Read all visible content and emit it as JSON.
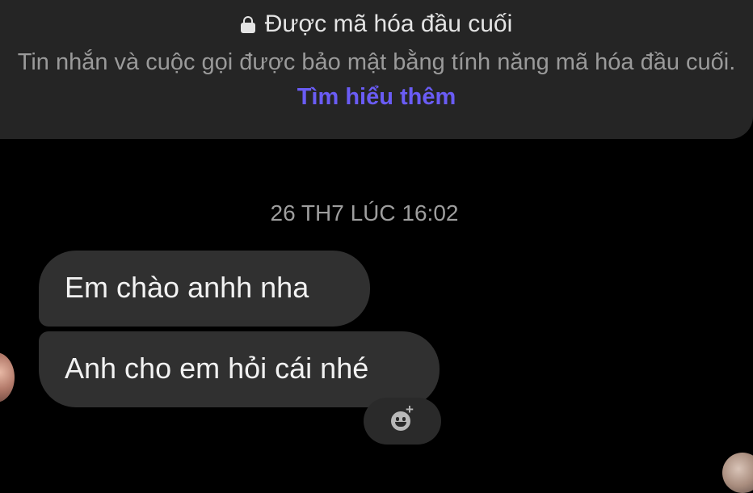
{
  "encryption_notice": {
    "title": "Được mã hóa đầu cuối",
    "description": "Tin nhắn và cuộc gọi được bảo mật bằng tính năng mã hóa đầu cuối.",
    "learn_more": "Tìm hiểu thêm",
    "icon": "lock-icon"
  },
  "conversation": {
    "timestamp": "26 TH7 LÚC 16:02",
    "messages": [
      {
        "text": "Em chào anhh nha",
        "sender": "other"
      },
      {
        "text": "Anh cho em hỏi cái nhé",
        "sender": "other"
      }
    ],
    "reaction_icon": "smiley-plus-icon"
  },
  "colors": {
    "background": "#000000",
    "banner": "#252525",
    "bubble": "#303030",
    "link": "#6a5cf5"
  }
}
